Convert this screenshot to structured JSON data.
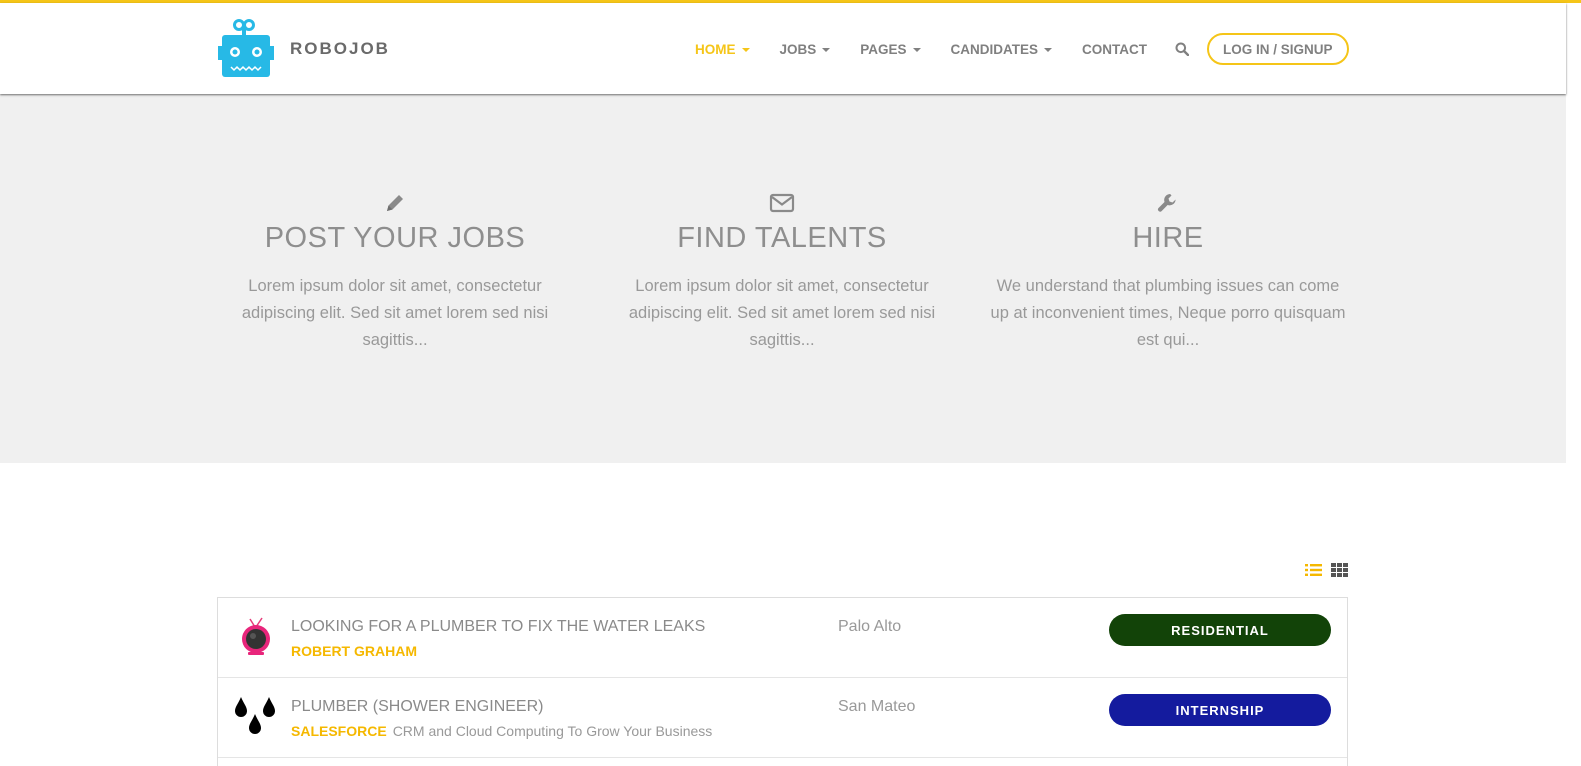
{
  "brand": {
    "name": "ROBOJOB",
    "accent": "#f5c518"
  },
  "nav": {
    "items": [
      {
        "label": "HOME",
        "dropdown": true,
        "active": true
      },
      {
        "label": "JOBS",
        "dropdown": true
      },
      {
        "label": "PAGES",
        "dropdown": true
      },
      {
        "label": "CANDIDATES",
        "dropdown": true
      },
      {
        "label": "CONTACT",
        "dropdown": false
      }
    ],
    "search_icon": "search-icon",
    "login_label": "LOG IN / SIGNUP"
  },
  "features": [
    {
      "icon": "pencil-icon",
      "title": "POST YOUR JOBS",
      "text": "Lorem ipsum dolor sit amet, consectetur adipiscing elit. Sed sit amet lorem sed nisi sagittis..."
    },
    {
      "icon": "envelope-icon",
      "title": "FIND TALENTS",
      "text": "Lorem ipsum dolor sit amet, consectetur adipiscing elit. Sed sit amet lorem sed nisi sagittis..."
    },
    {
      "icon": "wrench-icon",
      "title": "HIRE",
      "text": "We understand that plumbing issues can come up at inconvenient times, Neque porro quisquam est qui..."
    }
  ],
  "view_toggle": {
    "list_icon": "list-view-icon",
    "grid_icon": "grid-view-icon",
    "active": "list"
  },
  "jobs": [
    {
      "title": "LOOKING FOR A PLUMBER TO FIX THE WATER LEAKS",
      "company": "ROBERT GRAHAM",
      "tagline": "",
      "location": "Palo Alto",
      "type": "RESIDENTIAL",
      "type_color": "#124308",
      "logo": "tv-logo-icon"
    },
    {
      "title": "PLUMBER (SHOWER ENGINEER)",
      "company": "SALESFORCE",
      "tagline": "CRM and Cloud Computing To Grow Your Business",
      "location": "San Mateo",
      "type": "INTERNSHIP",
      "type_color": "#141b9e",
      "logo": "water-drops-logo-icon"
    }
  ]
}
